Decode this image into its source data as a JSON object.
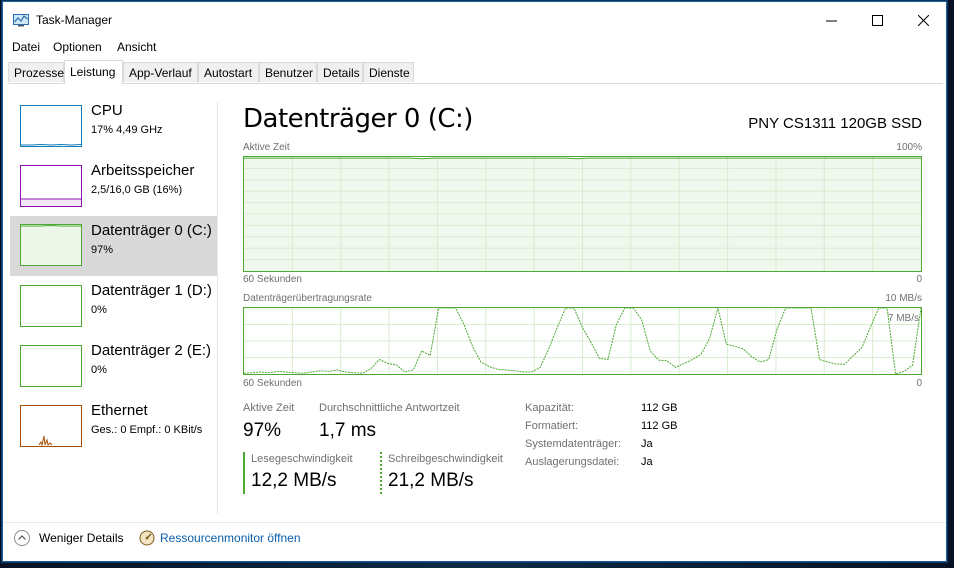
{
  "window": {
    "title": "Task-Manager",
    "minimize": "—",
    "maximize": "☐",
    "close": "✕"
  },
  "menu": [
    "Datei",
    "Optionen",
    "Ansicht"
  ],
  "tabs": [
    "Prozesse",
    "Leistung",
    "App-Verlauf",
    "Autostart",
    "Benutzer",
    "Details",
    "Dienste"
  ],
  "active_tab": "Leistung",
  "sidebar": [
    {
      "name": "CPU",
      "value": "17% 4,49 GHz",
      "color": "#117dbb"
    },
    {
      "name": "Arbeitsspeicher",
      "value": "2,5/16,0 GB (16%)",
      "color": "#8b12ae"
    },
    {
      "name": "Datenträger 0 (C:)",
      "value": "97%",
      "color": "#4da834"
    },
    {
      "name": "Datenträger 1 (D:)",
      "value": "0%",
      "color": "#4da834"
    },
    {
      "name": "Datenträger 2 (E:)",
      "value": "0%",
      "color": "#4da834"
    },
    {
      "name": "Ethernet",
      "value": "Ges.: 0 Empf.: 0 KBit/s",
      "color": "#a74f01"
    }
  ],
  "main": {
    "title": "Datenträger 0 (C:)",
    "device": "PNY CS1311 120GB SSD",
    "graph1": {
      "label": "Aktive Zeit",
      "max": "100%",
      "time": "60 Sekunden",
      "min": "0",
      "values": [
        99,
        99,
        99,
        99,
        99,
        99,
        99,
        99,
        99,
        99,
        99,
        99,
        99,
        99,
        99,
        99,
        98.5,
        99,
        99,
        99,
        99,
        99,
        99,
        99,
        99,
        99,
        99,
        99,
        99,
        99,
        98.5,
        99,
        99,
        99,
        99,
        99,
        99,
        99,
        99,
        99,
        99,
        99,
        99,
        99,
        99,
        99,
        99,
        99,
        99,
        99,
        99,
        99,
        99,
        99,
        99,
        99,
        99,
        99,
        99,
        99,
        99,
        99
      ]
    },
    "graph2": {
      "label": "Datenträgerübertragungsrate",
      "max": "10 MB/s",
      "inner": "7 MB/s",
      "time": "60 Sekunden",
      "min": "0",
      "values": [
        0.1,
        0.2,
        0.3,
        0.2,
        0.4,
        0.3,
        0.2,
        0.1,
        0.3,
        0.5,
        0.4,
        0.6,
        0.3,
        0.2,
        0.1,
        0.8,
        2.2,
        1.6,
        1.4,
        0.3,
        0.6,
        3.5,
        2.8,
        10,
        10,
        10,
        7.5,
        4.2,
        1.8,
        1.1,
        0.7,
        0.6,
        0.5,
        0.3,
        0.3,
        1.0,
        3.8,
        7.0,
        10,
        10,
        7.0,
        4.8,
        2.4,
        2.2,
        7.5,
        10,
        10,
        8.2,
        3.5,
        2.1,
        2.0,
        1.0,
        1.6,
        2.2,
        3.0,
        5.3,
        10,
        4.5,
        4.2,
        3.8,
        2.6,
        1.8,
        2.2,
        6.8,
        10,
        10,
        10,
        10,
        2.2,
        1.8,
        1.5,
        1.5,
        2.8,
        4.0,
        7.0,
        10,
        10,
        0.0,
        0.4,
        1.3,
        10
      ]
    }
  },
  "stats": {
    "active_time_label": "Aktive Zeit",
    "active_time": "97%",
    "response_label": "Durchschnittliche Antwortzeit",
    "response": "1,7 ms",
    "read_label": "Lesegeschwindigkeit",
    "read": "12,2 MB/s",
    "write_label": "Schreibgeschwindigkeit",
    "write": "21,2 MB/s"
  },
  "properties": [
    {
      "key": "Kapazität:",
      "value": "112 GB"
    },
    {
      "key": "Formatiert:",
      "value": "112 GB"
    },
    {
      "key": "Systemdatenträger:",
      "value": "Ja"
    },
    {
      "key": "Auslagerungsdatei:",
      "value": "Ja"
    }
  ],
  "footer": {
    "less_details": "Weniger Details",
    "resmon": "Ressourcenmonitor öffnen"
  },
  "icons": {
    "app": "task-manager-icon",
    "chevron": "chevron-up-icon",
    "resmon": "resource-monitor-icon"
  }
}
